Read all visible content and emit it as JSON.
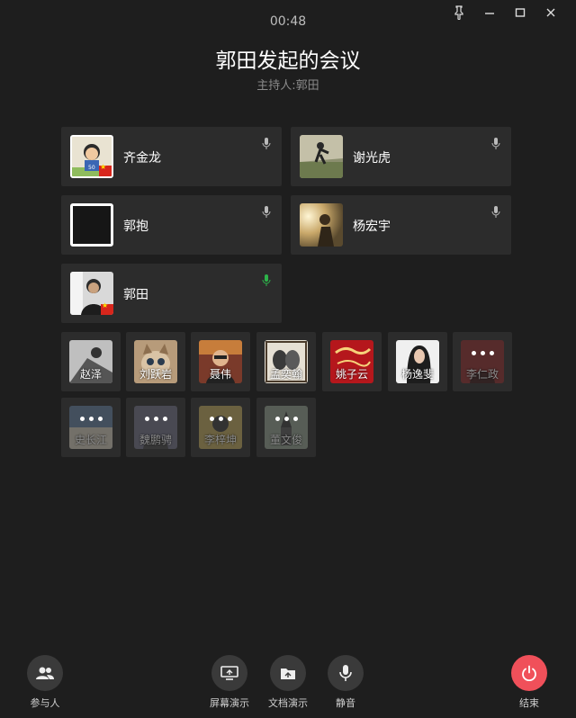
{
  "timer": "00:48",
  "title": "郭田发起的会议",
  "host": "主持人:郭田",
  "participants": [
    {
      "name": "齐金龙"
    },
    {
      "name": "谢光虎"
    },
    {
      "name": "郭抱"
    },
    {
      "name": "杨宏宇"
    },
    {
      "name": "郭田"
    }
  ],
  "others": [
    {
      "name": "赵泽"
    },
    {
      "name": "刘跃岩"
    },
    {
      "name": "聂伟"
    },
    {
      "name": "孟奕翰"
    },
    {
      "name": "姚子云"
    },
    {
      "name": "杨逸斐"
    },
    {
      "name": "李仁政"
    },
    {
      "name": "史长江"
    },
    {
      "name": "魏鹏骋"
    },
    {
      "name": "李梓坤"
    },
    {
      "name": "董文俊"
    }
  ],
  "toolbar": {
    "participants_label": "参与人",
    "screen_share_label": "屏幕演示",
    "doc_share_label": "文档演示",
    "mute_label": "静音",
    "end_label": "结束"
  },
  "colors": {
    "active_mic": "#2db34a",
    "end_button": "#f0505a"
  }
}
